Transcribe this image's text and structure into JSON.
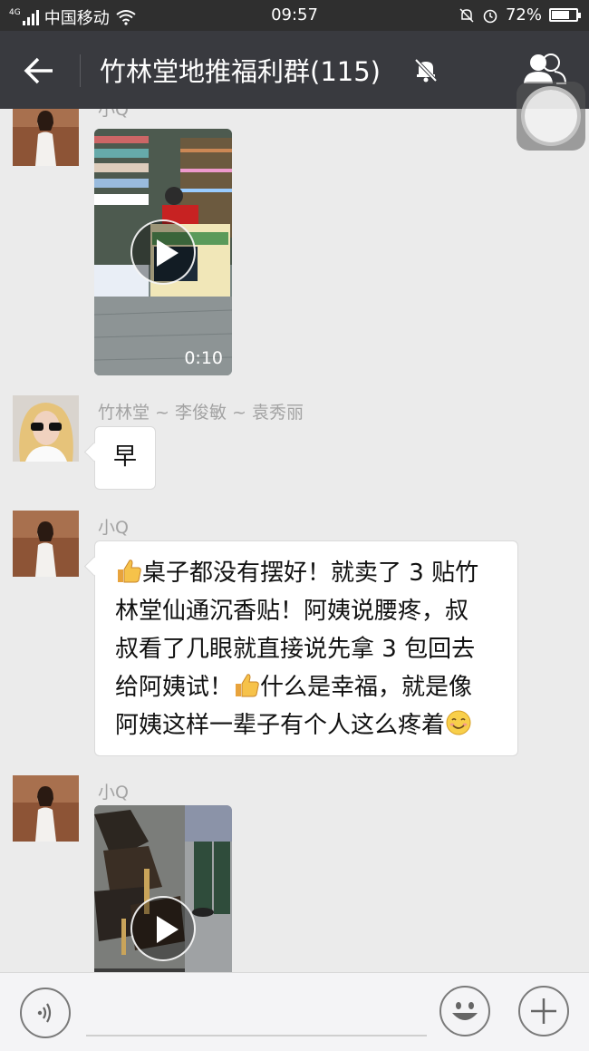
{
  "status_bar": {
    "carrier": "中国移动",
    "network": "4G",
    "time": "09:57",
    "battery": "72%",
    "battery_level": 0.72
  },
  "header": {
    "title": "竹林堂地推福利群(115)",
    "back_icon": "arrow-left-icon",
    "mute_icon": "bell-muted-icon",
    "members_icon": "group-members-icon"
  },
  "messages": [
    {
      "type": "video",
      "sender": "小Q",
      "duration": "0:10"
    },
    {
      "type": "text",
      "sender": "竹林堂 ~ 李俊敏 ~ 袁秀丽",
      "text": "早"
    },
    {
      "type": "text",
      "sender": "小Q",
      "lines": [
        "桌子都没有摆好！就卖了 3 贴竹",
        "林堂仙通沉香贴！阿姨说腰疼，叔",
        "叔看了几眼就直接说先拿 3 包回去",
        "给阿姨试！",
        "什么是幸福，就是像",
        "阿姨这样一辈子有个人这么疼着"
      ],
      "emoji": [
        "thumbs-up-icon",
        "thumbs-up-icon",
        "smiling-face-icon"
      ]
    },
    {
      "type": "video",
      "sender": "小Q"
    }
  ],
  "input_bar": {
    "voice_icon": "voice-icon",
    "emoji_icon": "smiley-icon",
    "plus_icon": "plus-icon"
  },
  "colors": {
    "titlebar": "#393a3f",
    "statusbar": "#2f2f2f",
    "chat_bg": "#ebebeb",
    "bubble": "#ffffff"
  }
}
